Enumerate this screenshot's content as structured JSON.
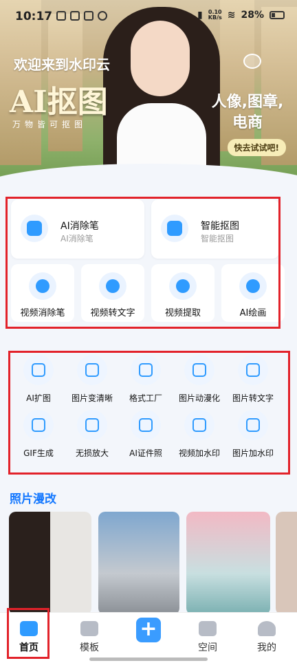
{
  "status": {
    "time": "10:17",
    "net": "0.10\nKB/s",
    "battery": "28%"
  },
  "banner": {
    "welcome": "欢迎来到水印云",
    "title": "AI抠图",
    "subtitle": "万物皆可抠图",
    "tag_line1": "人像,图章,",
    "tag_line2": "电商",
    "cta": "快去试试吧!"
  },
  "features": {
    "big": [
      {
        "title": "AI消除笔",
        "subtitle": "AI消除笔"
      },
      {
        "title": "智能抠图",
        "subtitle": "智能抠图"
      }
    ],
    "small": [
      "视频消除笔",
      "视频转文字",
      "视频提取",
      "AI绘画"
    ]
  },
  "tools": [
    "AI扩图",
    "图片变清晰",
    "格式工厂",
    "图片动漫化",
    "图片转文字",
    "GIF生成",
    "无损放大",
    "AI证件照",
    "视频加水印",
    "图片加水印"
  ],
  "section": {
    "title": "照片漫改"
  },
  "tabs": [
    "首页",
    "模板",
    "+",
    "空间",
    "我的"
  ]
}
